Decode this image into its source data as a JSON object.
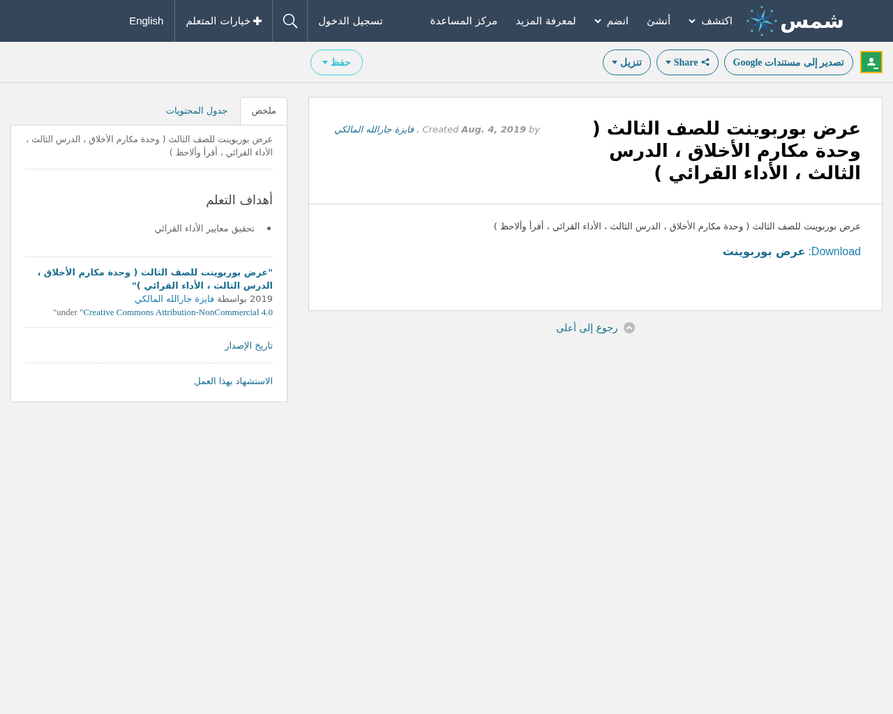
{
  "header": {
    "logo_text": "شمس",
    "nav": [
      {
        "label": "اكتشف",
        "dropdown": true
      },
      {
        "label": "أنشئ",
        "dropdown": false
      },
      {
        "label": "انضم",
        "dropdown": true
      },
      {
        "label": "لمعرفة المزيد",
        "dropdown": false
      },
      {
        "label": "مركز المساعدة",
        "dropdown": false
      }
    ],
    "login": "تسجيل الدخول",
    "learner_options": "خيارات المتعلم",
    "language": "English"
  },
  "toolbar": {
    "buttons": [
      {
        "kind": "google",
        "label": "تصدير إلى مستندات Google"
      },
      {
        "kind": "share",
        "label": "Share"
      },
      {
        "kind": "download",
        "label": "تنزيل"
      }
    ],
    "save": "حفظ"
  },
  "article": {
    "title": "عرض بوربوينت للصف الثالث ( وحدة مكارم الأخلاق ، الدرس الثالث ، الأداء القرائي )",
    "by_label": "by",
    "date": "Aug. 4, 2019",
    "created_label": ", Created",
    "author": "فايزة جارالله المالكي",
    "description": "عرض بوربوينت للصف الثالث ( وحدة مكارم الأخلاق ، الدرس الثالث ، الأداء القرائي ، أقرأ وألاحظ )",
    "download_label": "Download:",
    "download_link": "عرض بوربوينت"
  },
  "back_to_top": "رجوع إلى أعلى",
  "sidebar": {
    "tabs": [
      {
        "label": "ملخص",
        "selected": true
      },
      {
        "label": "جدول المحتويات",
        "selected": false
      }
    ],
    "summary": "عرض بوربوينت للصف الثالث ( وحدة مكارم الأخلاق ، الدرس الثالث ، الأداء القرائي ، أقرأ وألاحظ )",
    "objectives_heading": "أهداف التعلم",
    "objectives": [
      "تحقيق معايير الأداء القرائي"
    ],
    "attribution": {
      "title": "\"عرض بوربوينت للصف الثالث ( وحدة مكارم الأخلاق ، الدرس الثالث ، الأداء القرائي )\"",
      "by_text": "2019 بواسطة",
      "author": "فايزة جارالله المالكي",
      "under_label": "\"under ",
      "license": "\"Creative Commons Attribution-NonCommercial 4.0"
    },
    "links": [
      "تاريخ الإصدار",
      "الاستشهاد بهذا العمل"
    ]
  }
}
